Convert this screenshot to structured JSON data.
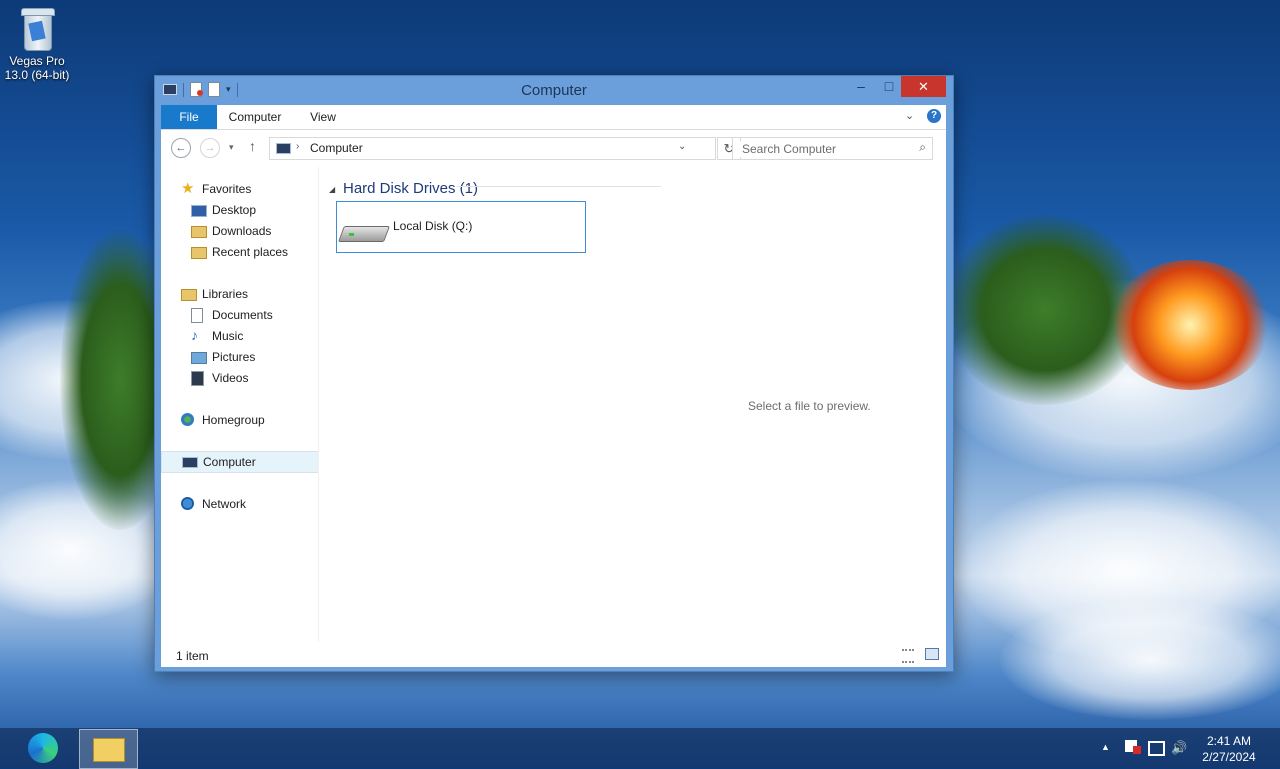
{
  "desktop": {
    "icons": [
      {
        "label_line1": "Vegas Pro",
        "label_line2": "13.0 (64-bit)",
        "icon": "recycle-bin-icon"
      }
    ]
  },
  "window": {
    "title": "Computer",
    "controls": {
      "minimize": "–",
      "maximize": "□",
      "close": "✕"
    },
    "ribbon": {
      "file": "File",
      "tabs": [
        "Computer",
        "View"
      ],
      "expand": "⌄",
      "help": "?"
    },
    "nav": {
      "back": "←",
      "forward": "→",
      "recent": "▾",
      "up": "↑",
      "address": "Computer",
      "address_sep": "›",
      "address_drop": "⌄",
      "refresh": "↻",
      "search_placeholder": "Search Computer"
    },
    "sidebar": {
      "favorites": {
        "label": "Favorites",
        "items": [
          "Desktop",
          "Downloads",
          "Recent places"
        ]
      },
      "libraries": {
        "label": "Libraries",
        "items": [
          "Documents",
          "Music",
          "Pictures",
          "Videos"
        ]
      },
      "homegroup": "Homegroup",
      "computer": "Computer",
      "network": "Network"
    },
    "content": {
      "group_caret": "◢",
      "group_title": "Hard Disk Drives (1)",
      "drives": [
        {
          "label": "Local Disk (Q:)",
          "icon": "hard-drive-icon"
        }
      ],
      "preview_text": "Select a file to preview."
    },
    "status": {
      "count": "1 item"
    }
  },
  "taskbar": {
    "apps": [
      {
        "name": "Microsoft Edge",
        "icon": "edge-icon"
      },
      {
        "name": "File Explorer",
        "icon": "folder-icon"
      }
    ],
    "tray_arrow": "▲",
    "volume": "🔊",
    "time": "2:41 AM",
    "date": "2/27/2024"
  },
  "colors": {
    "accent": "#1979ca",
    "close": "#c7352c",
    "window_frame": "#6b9fdb"
  }
}
